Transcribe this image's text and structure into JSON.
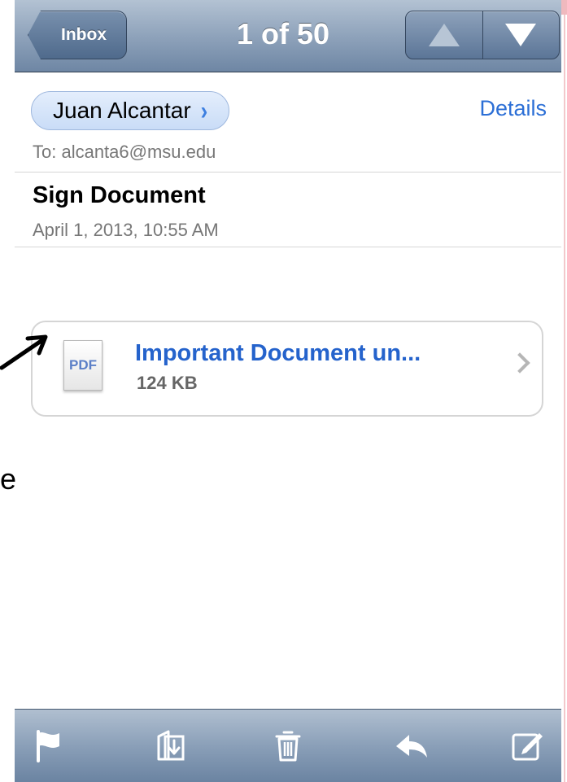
{
  "navbar": {
    "back_label": "Inbox",
    "title": "1 of 50"
  },
  "message": {
    "from": "Juan Alcantar",
    "details_label": "Details",
    "to": "To: alcanta6@msu.edu",
    "subject": "Sign Document",
    "date": "April 1, 2013, 10:55 AM"
  },
  "attachment": {
    "type_label": "PDF",
    "name": "Important Document un...",
    "size": "124 KB"
  },
  "annotation": {
    "stray_text": "e"
  },
  "toolbar": {
    "items": [
      "flag-icon",
      "move-to-folder-icon",
      "trash-icon",
      "reply-icon",
      "compose-icon"
    ]
  },
  "colors": {
    "link": "#2563cc",
    "nav_bar": "#8fa3bb"
  }
}
